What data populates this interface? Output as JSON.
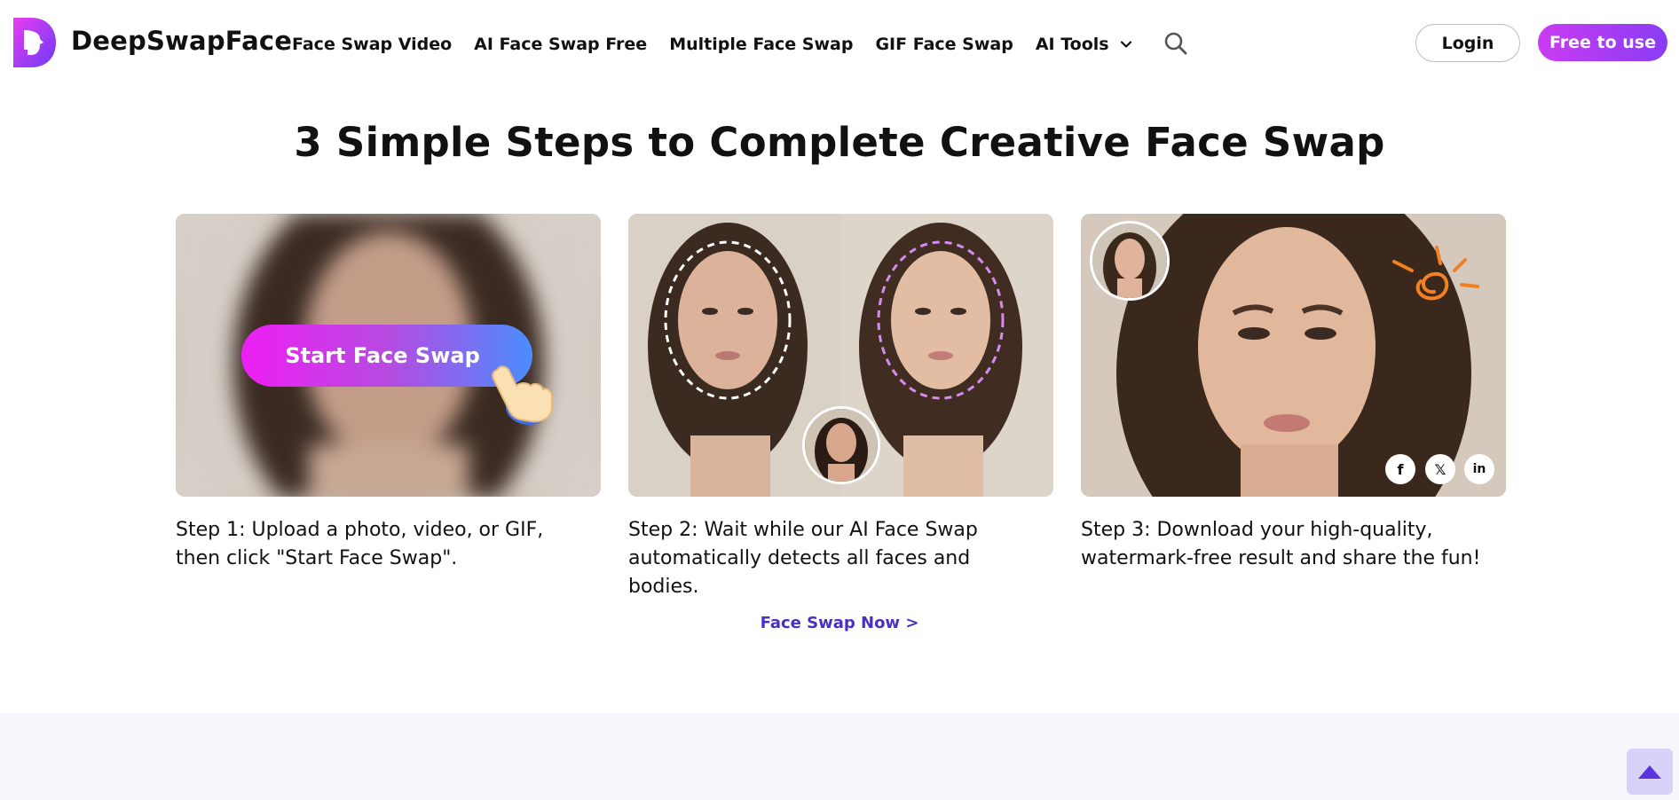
{
  "header": {
    "brand": "DeepSwapFace",
    "nav": [
      "Face Swap Video",
      "AI Face Swap Free",
      "Multiple Face Swap",
      "GIF Face Swap",
      "AI Tools"
    ],
    "login": "Login",
    "cta": "Free to use"
  },
  "section": {
    "title": "3 Simple Steps to Complete Creative Face Swap",
    "card1_button": "Start Face Swap",
    "steps": [
      {
        "text": "Step 1: Upload a photo, video, or GIF, then click \"Start Face Swap\"."
      },
      {
        "text": "Step 2: Wait while our AI Face Swap automatically detects all faces and bodies."
      },
      {
        "text": "Step 3: Download your high-quality, watermark-free result and share the fun!"
      }
    ],
    "cta_link": "Face Swap Now >"
  },
  "icons": {
    "logo": "deepswapface-logo",
    "search": "search-icon",
    "chevron": "chevron-down-icon",
    "share": [
      "facebook-icon",
      "x-icon",
      "linkedin-icon"
    ],
    "scroll_top": "arrow-up-icon"
  },
  "colors": {
    "brand_gradient_start": "#c93cf2",
    "brand_gradient_end": "#8a3cf5",
    "link": "#4a2fc2",
    "footer_bg": "#f7f6fd"
  }
}
